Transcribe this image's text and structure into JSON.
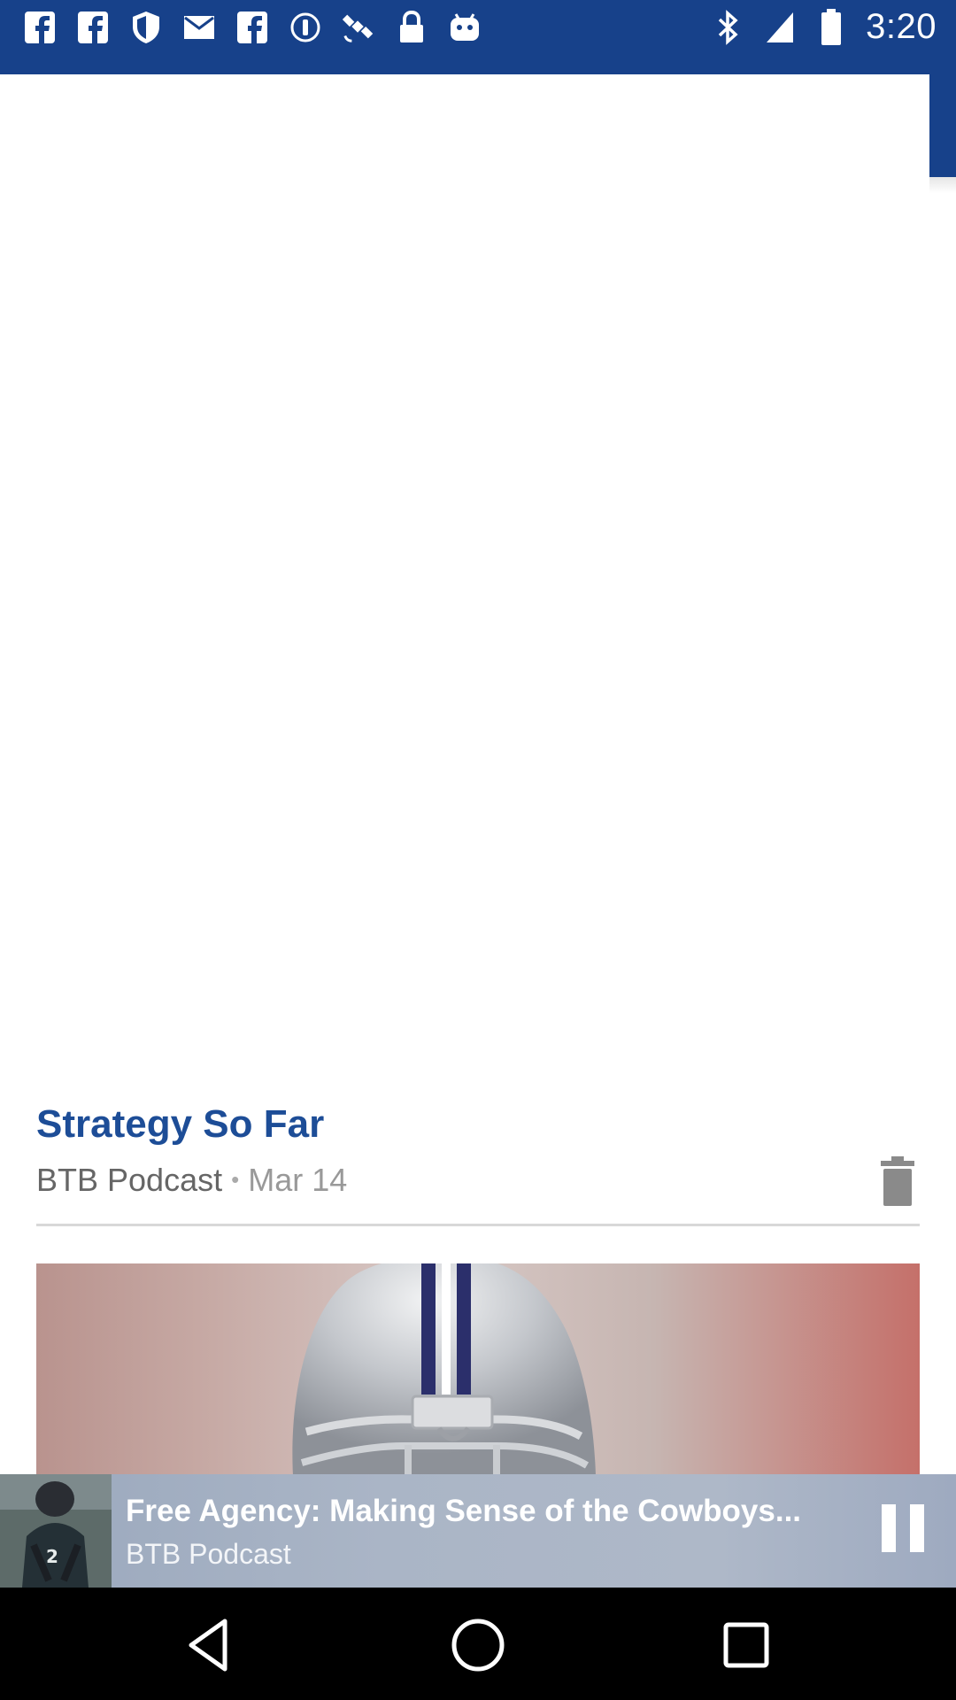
{
  "status_bar": {
    "time": "3:20",
    "left_icons": [
      "facebook-icon",
      "facebook-icon",
      "shield-icon",
      "mail-icon",
      "facebook-icon",
      "info-circle-icon",
      "satellite-icon",
      "lock-icon",
      "android-icon"
    ],
    "right_icons": [
      "bluetooth-icon",
      "signal-icon",
      "battery-icon"
    ],
    "color": "#17418a"
  },
  "episode": {
    "title": "Strategy So Far",
    "source": "BTB Podcast",
    "separator": "•",
    "date": "Mar 14"
  },
  "mini_player": {
    "title": "Free Agency: Making Sense of the Cowboys...",
    "subtitle": "BTB Podcast"
  },
  "colors": {
    "brand_blue": "#17418a",
    "title_blue": "#1d4d97"
  }
}
